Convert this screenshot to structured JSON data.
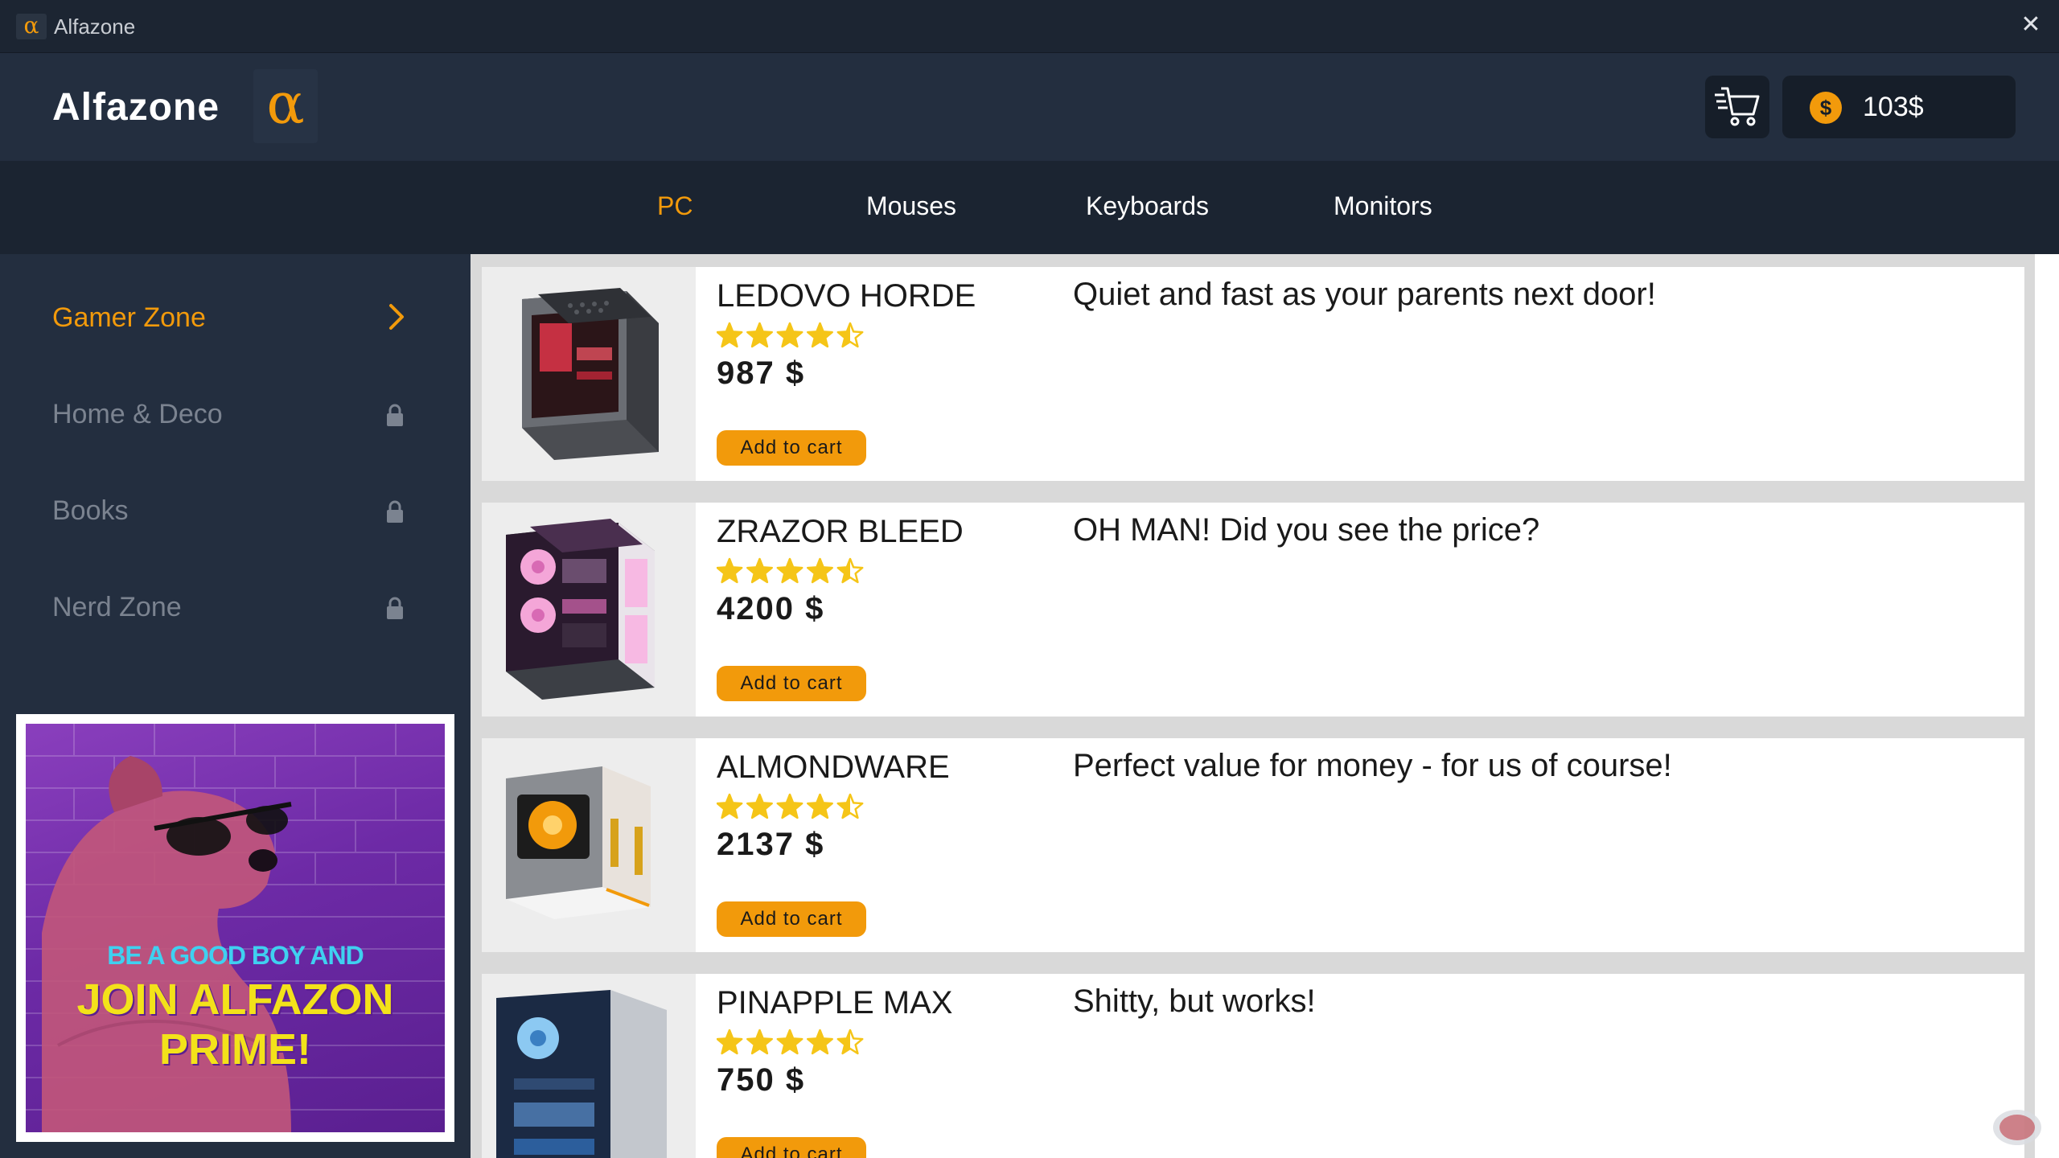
{
  "window": {
    "title": "Alfazone",
    "app_icon": "alpha-icon",
    "close_glyph": "✕"
  },
  "header": {
    "brand_name": "Alfazone",
    "brand_logo_glyph": "α",
    "cart_icon": "cart-icon",
    "wallet": {
      "coin_glyph": "$",
      "amount": "103$"
    }
  },
  "categories": [
    {
      "label": "PC",
      "active": true
    },
    {
      "label": "Mouses",
      "active": false
    },
    {
      "label": "Keyboards",
      "active": false
    },
    {
      "label": "Monitors",
      "active": false
    }
  ],
  "sidebar": {
    "items": [
      {
        "label": "Gamer Zone",
        "state": "active",
        "icon": "chevron-right-icon"
      },
      {
        "label": "Home & Deco",
        "state": "locked",
        "icon": "lock-icon"
      },
      {
        "label": "Books",
        "state": "locked",
        "icon": "lock-icon"
      },
      {
        "label": "Nerd Zone",
        "state": "locked",
        "icon": "lock-icon"
      }
    ],
    "promo": {
      "line1": "BE A GOOD BOY AND",
      "line2": "JOIN ALFAZON PRIME!"
    }
  },
  "products": [
    {
      "name": "LEDOVO HORDE",
      "rating": 4.5,
      "price": "987 $",
      "description": "Quiet and fast as your parents next door!",
      "button": "Add to cart",
      "theme": "red"
    },
    {
      "name": "ZRAZOR BLEED",
      "rating": 4.5,
      "price": "4200 $",
      "description": "OH MAN! Did you see the price?",
      "button": "Add to cart",
      "theme": "pink"
    },
    {
      "name": "ALMONDWARE",
      "rating": 4.5,
      "price": "2137 $",
      "description": "Perfect value for money - for us of course!",
      "button": "Add to cart",
      "theme": "orange"
    },
    {
      "name": "PINAPPLE MAX",
      "rating": 4.5,
      "price": "750 $",
      "description": "Shitty, but works!",
      "button": "Add to cart",
      "theme": "blue"
    }
  ],
  "colors": {
    "accent": "#f29a0b",
    "star": "#f5c518",
    "bg_dark": "#1b2431",
    "panel": "#232e3f"
  }
}
